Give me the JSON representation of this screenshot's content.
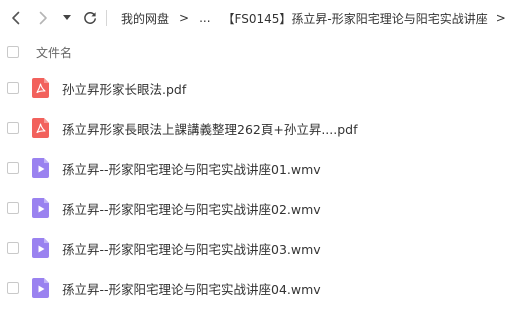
{
  "nav": {
    "back_icon": "chevron-left-icon",
    "forward_icon": "chevron-right-icon",
    "dropdown_icon": "caret-down-icon",
    "refresh_icon": "refresh-icon",
    "breadcrumb": {
      "root": "我的网盘",
      "separator": ">",
      "ellipsis": "...",
      "current": "【FS0145】孫立昇-形家阳宅理论与阳宅实战讲座",
      "trailing_separator": ">"
    }
  },
  "list": {
    "header": {
      "name_column": "文件名"
    },
    "files": [
      {
        "name": "孙立昇形家长眼法.pdf",
        "type": "pdf",
        "icon": "pdf-icon"
      },
      {
        "name": "孫立昇形家長眼法上課講義整理262頁+孙立昇....pdf",
        "type": "pdf",
        "icon": "pdf-icon"
      },
      {
        "name": "孫立昇--形家阳宅理论与阳宅实战讲座01.wmv",
        "type": "video",
        "icon": "video-file-icon"
      },
      {
        "name": "孫立昇--形家阳宅理论与阳宅实战讲座02.wmv",
        "type": "video",
        "icon": "video-file-icon"
      },
      {
        "name": "孫立昇--形家阳宅理论与阳宅实战讲座03.wmv",
        "type": "video",
        "icon": "video-file-icon"
      },
      {
        "name": "孫立昇--形家阳宅理论与阳宅实战讲座04.wmv",
        "type": "video",
        "icon": "video-file-icon"
      }
    ]
  },
  "colors": {
    "pdf_icon": "#f2615c",
    "video_icon": "#9a82f0",
    "text": "#333333",
    "muted": "#666666",
    "checkbox_border": "#c9c9c9"
  }
}
